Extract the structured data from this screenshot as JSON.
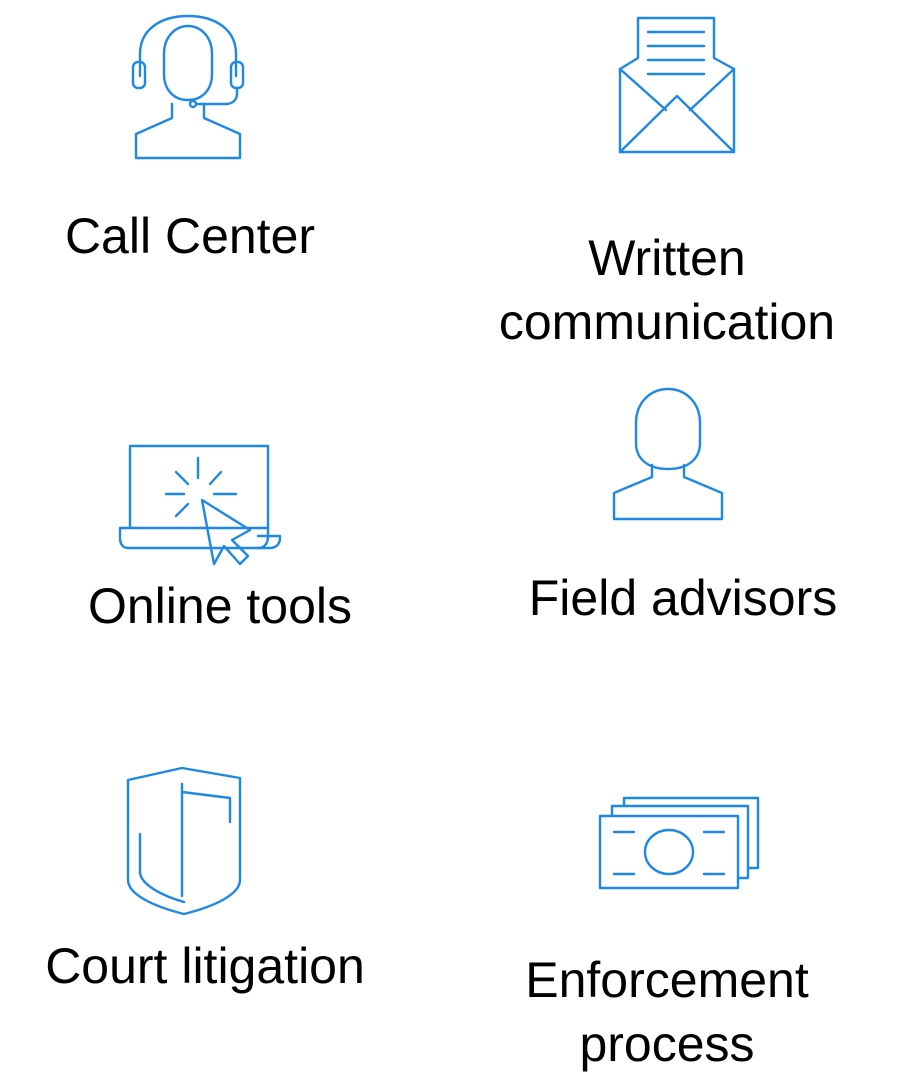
{
  "accent_color": "#1e88e5",
  "items": [
    {
      "icon": "headset-person-icon",
      "label_lines": [
        "Call Center"
      ]
    },
    {
      "icon": "envelope-letter-icon",
      "label_lines": [
        "Written",
        "communication"
      ]
    },
    {
      "icon": "laptop-click-icon",
      "label_lines": [
        "Online tools"
      ]
    },
    {
      "icon": "person-icon",
      "label_lines": [
        "Field advisors"
      ]
    },
    {
      "icon": "shield-icon",
      "label_lines": [
        "Court litigation"
      ]
    },
    {
      "icon": "banknotes-icon",
      "label_lines": [
        "Enforcement",
        "process"
      ]
    }
  ]
}
